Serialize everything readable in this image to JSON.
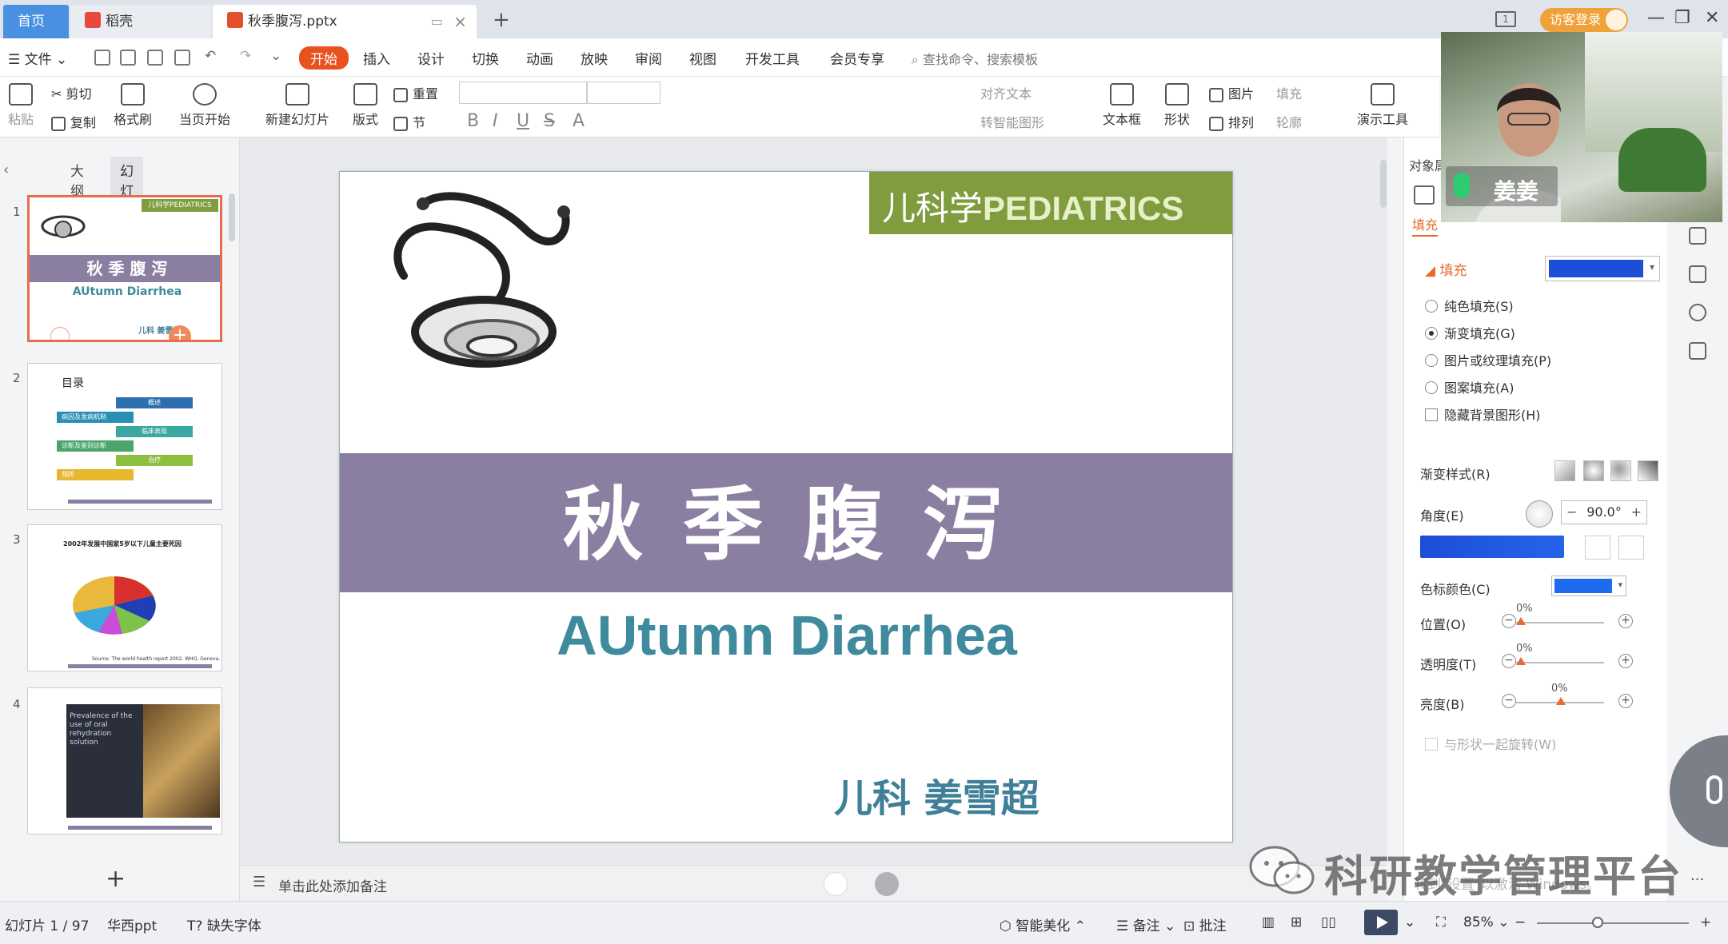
{
  "tabs": {
    "home": "首页",
    "docer": "稻壳",
    "file": "秋季腹泻.pptx",
    "new_tab": "+"
  },
  "titlebar": {
    "guest_login": "访客登录",
    "screen_badge": "1"
  },
  "menu": {
    "file": "文件",
    "items": [
      "开始",
      "插入",
      "设计",
      "切换",
      "动画",
      "放映",
      "审阅",
      "视图",
      "开发工具",
      "会员专享"
    ],
    "search": "查找命令、搜索模板"
  },
  "ribbon": {
    "paste": "粘贴",
    "cut": "剪切",
    "copy": "复制",
    "format_painter": "格式刷",
    "from_current": "当页开始",
    "new_slide": "新建幻灯片",
    "layout": "版式",
    "reset": "重置",
    "section": "节",
    "align_text": "对齐文本",
    "smart_graphic": "转智能图形",
    "textbox": "文本框",
    "shape": "形状",
    "picture": "图片",
    "arrange": "排列",
    "fill": "填充",
    "outline": "轮廓",
    "present_tools": "演示工具"
  },
  "left_panel": {
    "tab_outline": "大纲",
    "tab_slides": "幻灯片",
    "thumb_numbers": [
      "1",
      "2",
      "3",
      "4"
    ],
    "thumb1": {
      "brand": "儿科学PEDIATRICS",
      "title": "秋 季 腹 泻",
      "subtitle": "AUtumn Diarrhea",
      "author": "儿科 姜雪超"
    },
    "thumb2": {
      "title": "目录",
      "items": [
        "概述",
        "病因及发病机制",
        "临床表现",
        "诊断及鉴别诊断",
        "治疗",
        "预防"
      ]
    },
    "thumb3": {
      "title": "2002年发展中国家5岁以下儿童主要死因",
      "source": "Source: The world health report 2002. WHO, Geneva."
    },
    "thumb4": {
      "text": "Prevalence of the use of oral rehydration solution"
    }
  },
  "slide": {
    "brand_cn": "儿科学",
    "brand_en": "PEDIATRICS",
    "title_cn": "秋季腹泻",
    "title_en": "AUtumn Diarrhea",
    "author": "儿科 姜雪超"
  },
  "notes": {
    "placeholder": "单击此处添加备注"
  },
  "right_panel": {
    "label": "对象属",
    "fill_tab": "填充",
    "fill_heading": "填充",
    "options": [
      {
        "label": "纯色填充(S)",
        "selected": false
      },
      {
        "label": "渐变填充(G)",
        "selected": true
      },
      {
        "label": "图片或纹理填充(P)",
        "selected": false
      },
      {
        "label": "图案填充(A)",
        "selected": false
      }
    ],
    "hide_bg": "隐藏背景图形(H)",
    "gradient_style": "渐变样式(R)",
    "angle_label": "角度(E)",
    "angle_value": "90.0°",
    "stop_color": "色标颜色(C)",
    "position": "位置(O)",
    "position_value": "0%",
    "transparency": "透明度(T)",
    "transparency_value": "0%",
    "brightness": "亮度(B)",
    "brightness_value": "0%",
    "rotate_with_shape": "与形状一起旋转(W)",
    "fill_color": "#1d4ed8",
    "stop_color_value": "#1d6cf0"
  },
  "video": {
    "name": "姜姜"
  },
  "status": {
    "slide_count": "幻灯片 1 / 97",
    "theme": "华西ppt",
    "missing_font": "缺失字体",
    "beautify": "智能美化",
    "notes": "备注",
    "comments": "批注",
    "zoom": "85%",
    "zoom_level": 0.4
  },
  "watermark": {
    "text": "科研教学管理平台",
    "windows": "转到\"设置\"以激活 Windows。"
  },
  "colors": {
    "accent": "#e9511f",
    "brand_green": "#7f9d3e",
    "title_band": "#8a7fa0",
    "title_en": "#3f8a9c"
  }
}
